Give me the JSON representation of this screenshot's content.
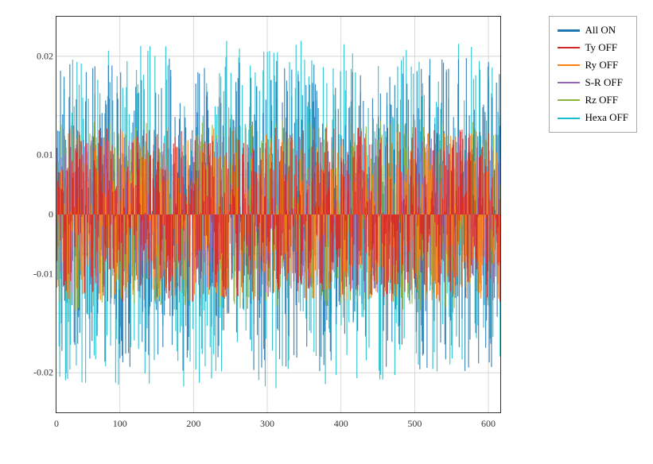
{
  "legend": {
    "items": [
      {
        "label": "All ON",
        "color": "#1f77b4",
        "thickness": 3
      },
      {
        "label": "Ty OFF",
        "color": "#d62728",
        "thickness": 2
      },
      {
        "label": "Ry OFF",
        "color": "#ff7f0e",
        "thickness": 2
      },
      {
        "label": "S-R OFF",
        "color": "#9467bd",
        "thickness": 2
      },
      {
        "label": "Rz OFF",
        "color": "#8cb33a",
        "thickness": 2
      },
      {
        "label": "Hexa OFF",
        "color": "#17becf",
        "thickness": 2
      }
    ]
  },
  "chart": {
    "x_ticks": [
      "0",
      "100",
      "200",
      "300",
      "400",
      "500",
      "600"
    ],
    "y_ticks": [
      "-0.02",
      "-0.01",
      "0",
      "0.01",
      "0.02"
    ],
    "title": ""
  }
}
